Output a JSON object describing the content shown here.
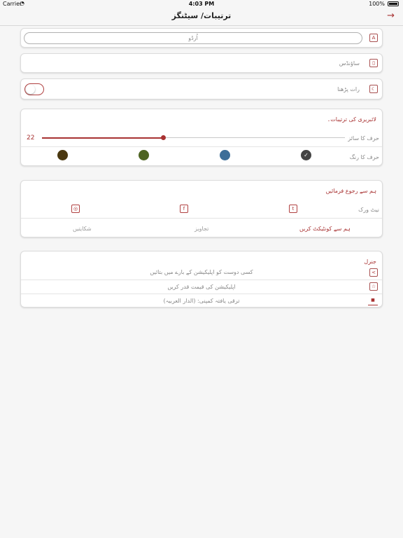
{
  "status_bar": {
    "carrier": "Carrier",
    "time": "4:03 PM",
    "battery": "100%"
  },
  "nav": {
    "title": "ترتیبات/ سیٹنگز",
    "back_icon": "arrow-right-icon"
  },
  "language": {
    "value": "اُردُو",
    "icon": "translate-icon"
  },
  "sounds": {
    "label": "ساؤنڈس",
    "icon": "microphone-icon"
  },
  "night_reading": {
    "label": "رات پڑھنا",
    "icon": "moon-icon",
    "enabled": false
  },
  "library": {
    "heading": "لائبریری کی ترتیبات۔",
    "font_size_label": "حرف کا سائز",
    "font_size_value": "22",
    "font_size_fraction": 0.4,
    "font_color_label": "حرف کا رنگ",
    "swatches": [
      {
        "color": "#4a3810",
        "selected": false
      },
      {
        "color": "#4e6422",
        "selected": false
      },
      {
        "color": "#3d6e98",
        "selected": false
      },
      {
        "color": "#444444",
        "selected": true
      }
    ]
  },
  "contact": {
    "heading": "ہم سے رجوع فرمائیں",
    "network_label": "نیٹ ورک",
    "social_icons": [
      "twitter-icon",
      "facebook-icon",
      "instagram-icon"
    ],
    "tabs": {
      "contact": "ہم سے کونٹیکٹ کریں",
      "suggestions": "تجاویز",
      "complaints": "شکایتیں"
    }
  },
  "general": {
    "heading": "جنرل",
    "rows": [
      {
        "label": "کسی دوست کو اپلیکیشن کے بارے میں بتائیں",
        "icon": "share-icon"
      },
      {
        "label": "اپلیکیشن کی قیمت قدر کریں",
        "icon": "star-icon"
      },
      {
        "label": "ترقی یافتہ کمپنی: (الدار العربیہ)",
        "icon": "company-logo-icon"
      }
    ]
  },
  "colors": {
    "accent": "#a83232",
    "background": "#f6f6f6"
  }
}
